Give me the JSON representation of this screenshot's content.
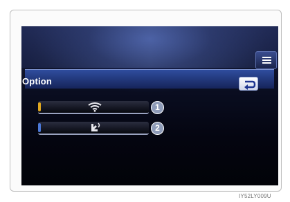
{
  "screen": {
    "title": "Option",
    "options": [
      {
        "icon": "wifi-icon",
        "indicator_color": "#e0a820",
        "callout": "1"
      },
      {
        "icon": "gesture-icon",
        "indicator_color": "#4b78d8",
        "callout": "2"
      }
    ],
    "menu_icon": "list-menu-icon",
    "back_icon": "return-arrow-icon"
  },
  "caption": "IY52LY009U",
  "colors": {
    "screen_bg": "#06081a",
    "title_bar": "#223a86",
    "callout": "#8e9bb8"
  }
}
